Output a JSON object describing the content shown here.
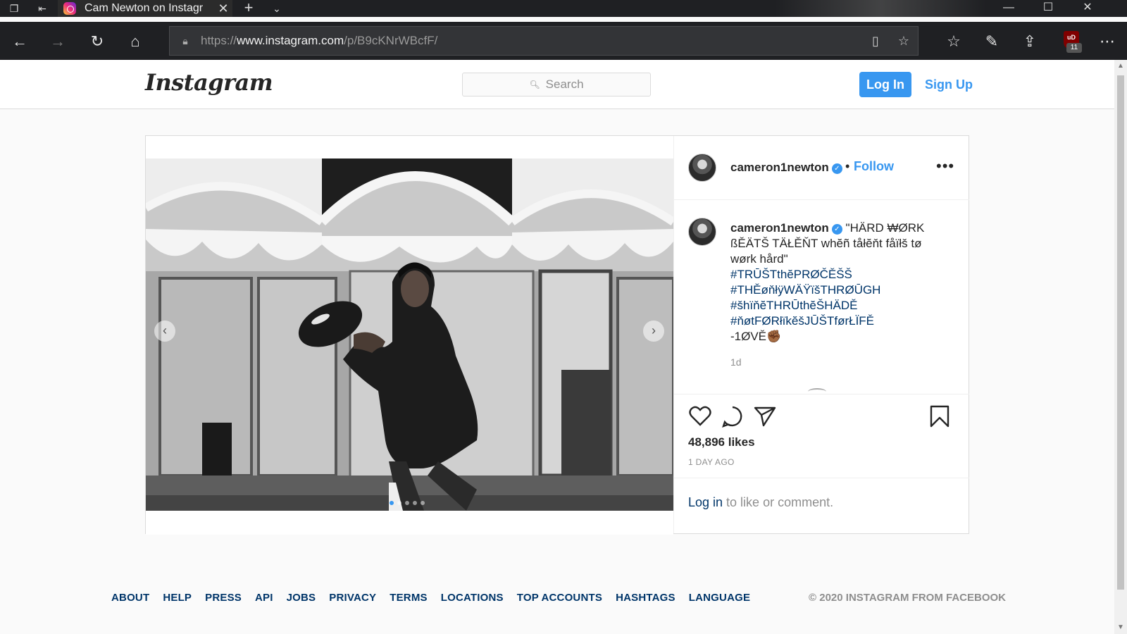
{
  "browser": {
    "tab_title": "Cam Newton on Instagr",
    "url_scheme": "https://",
    "url_host": "www.instagram.com",
    "url_path": "/p/B9cKNrWBcfF/",
    "ublock_badge": "11",
    "ublock_label": "uD"
  },
  "header": {
    "logo": "Instagram",
    "search_placeholder": "Search",
    "login_label": "Log In",
    "signup_label": "Sign Up"
  },
  "post": {
    "username": "cameron1newton",
    "follow_label": "Follow",
    "bullet": "•",
    "more_label": "•••",
    "caption_line1": "\"HÄRD ₩ØRK",
    "caption_line2": "ßĚÄTŠ TÄŁĚŇT whĕñ tåłĕňt fåïłš tø",
    "caption_line3": "wørk hård\"",
    "hashtags": [
      "#TRŪŠTthĕPRØČĚŠŠ",
      "#THĚøňłÿWÄŸïšTHRØŪGH",
      "#šhïňĕTHRŪthĕŠHÄDĚ",
      "#ňøtFØRłïkĕšJŪŠTførŁÏFĚ"
    ],
    "signoff": "-1ØVĚ✊🏾",
    "caption_time": "1d",
    "likes": "48,896 likes",
    "posted": "1 DAY AGO",
    "login_link": "Log in",
    "login_rest": " to like or comment.",
    "carousel_count": 5,
    "carousel_active": 1
  },
  "footer": {
    "links": [
      "ABOUT",
      "HELP",
      "PRESS",
      "API",
      "JOBS",
      "PRIVACY",
      "TERMS",
      "LOCATIONS",
      "TOP ACCOUNTS",
      "HASHTAGS",
      "LANGUAGE"
    ],
    "copyright": "© 2020 INSTAGRAM FROM FACEBOOK"
  },
  "colors": {
    "accent": "#3897f0",
    "link_dark": "#003569",
    "chrome_bg": "#1f2023"
  }
}
